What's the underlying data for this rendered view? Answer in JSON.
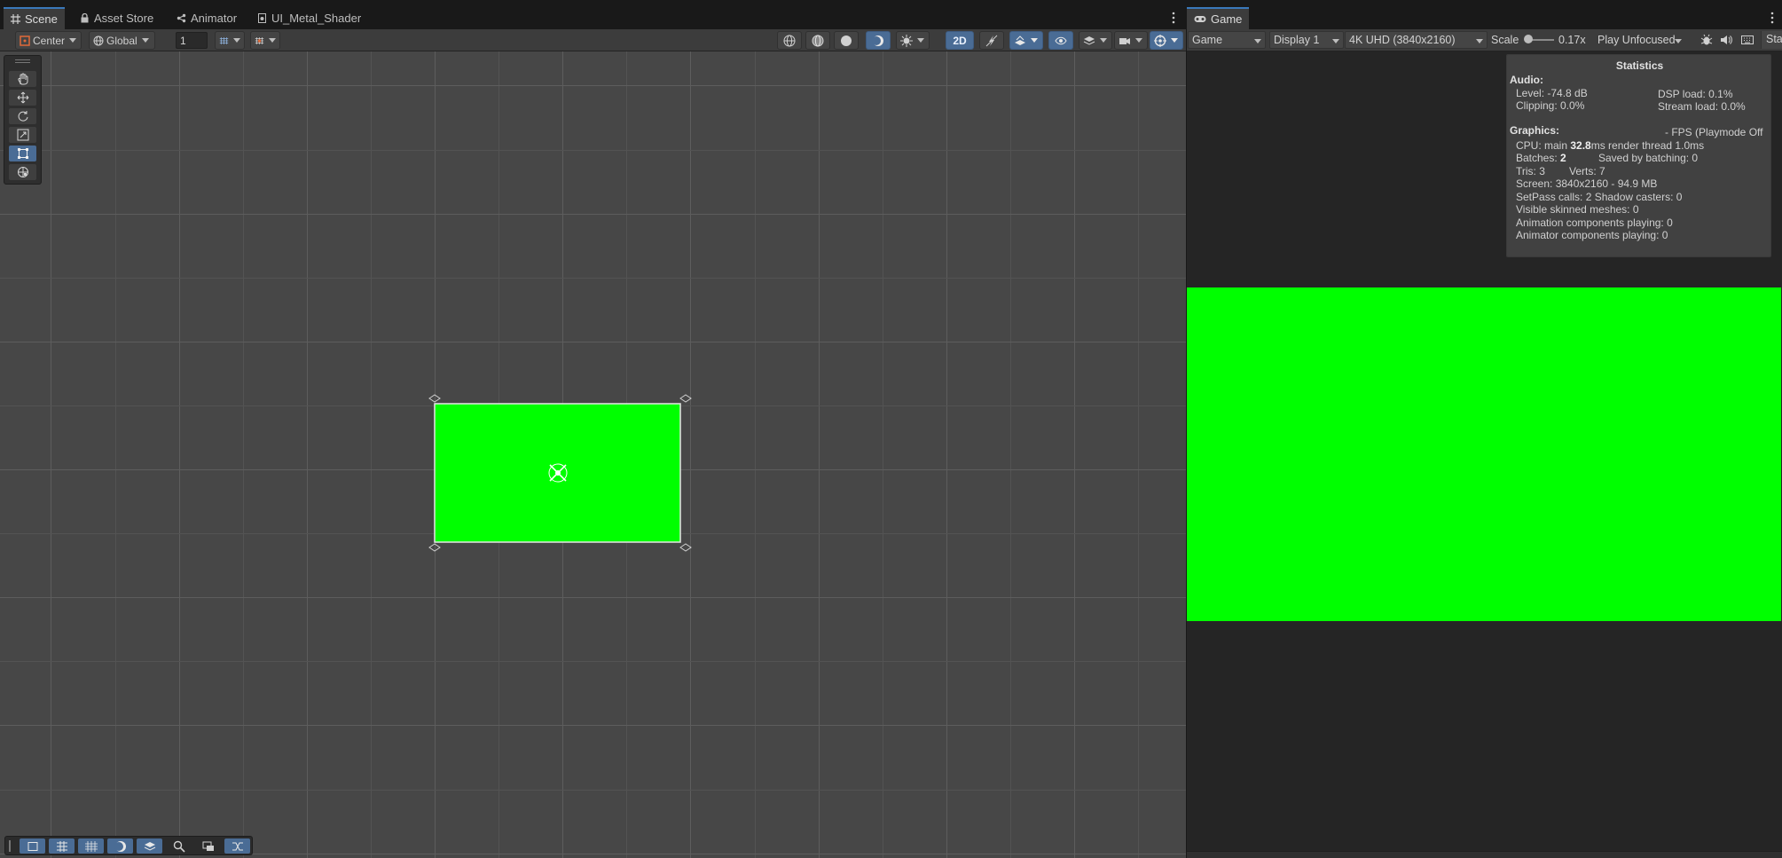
{
  "scene": {
    "tabs": [
      {
        "label": "Scene",
        "icon": "grid-icon"
      },
      {
        "label": "Asset Store",
        "icon": "lock-icon"
      },
      {
        "label": "Animator",
        "icon": "animator-icon"
      },
      {
        "label": "UI_Metal_Shader",
        "icon": "shader-icon"
      }
    ],
    "toolbar": {
      "pivot_mode": "Center",
      "pivot_rotation": "Global",
      "grid_value": "1",
      "mode_2d": "2D"
    },
    "tools": [
      "hand-tool",
      "move-tool",
      "rotate-tool",
      "scale-tool",
      "rect-tool",
      "transform-tool"
    ],
    "selected_tool": "rect-tool",
    "object_color": "#00ff00"
  },
  "game": {
    "tab_label": "Game",
    "view_mode": "Game",
    "display": "Display 1",
    "resolution": "4K UHD (3840x2160)",
    "scale_label": "Scale",
    "scale_value": "0.17x",
    "play_mode": "Play Unfocused",
    "render_color": "#00ff00",
    "stats": {
      "title": "Statistics",
      "audio_header": "Audio:",
      "level": "Level: -74.8 dB",
      "clipping": "Clipping: 0.0%",
      "dsp_load": "DSP load: 0.1%",
      "stream_load": "Stream load: 0.0%",
      "graphics_header": "Graphics:",
      "fps": "- FPS (Playmode Off",
      "cpu_main_prefix": "CPU: main ",
      "cpu_main_value": "32.8",
      "cpu_main_suffix": "ms  render thread 1.0ms",
      "batches_prefix": "Batches: ",
      "batches_value": "2",
      "saved_by_batching": "Saved by batching: 0",
      "tris": "Tris: 3",
      "verts": "Verts: 7",
      "screen": "Screen: 3840x2160 - 94.9 MB",
      "setpass": "SetPass calls: 2 Shadow casters: 0",
      "skinned": "Visible skinned meshes: 0",
      "animation": "Animation components playing: 0",
      "animator": "Animator components playing: 0"
    }
  }
}
